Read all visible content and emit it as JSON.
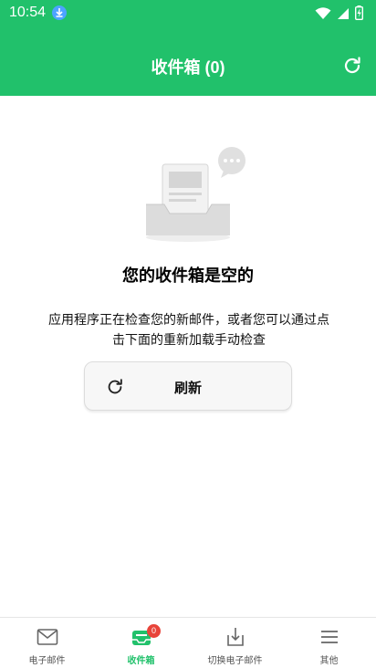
{
  "status_bar": {
    "time": "10:54",
    "icons": [
      "download-icon",
      "wifi-icon",
      "cell-signal-icon",
      "battery-icon"
    ]
  },
  "app_bar": {
    "title": "收件箱 (0)",
    "refresh_icon": "refresh-icon",
    "background": "#21c16b"
  },
  "empty_state": {
    "title": "您的收件箱是空的",
    "description": "应用程序正在检查您的新邮件，或者您可以通过点击下面的重新加载手动检查",
    "refresh_button_label": "刷新"
  },
  "bottom_nav": {
    "items": [
      {
        "label": "电子邮件",
        "icon": "mail-icon",
        "active": false
      },
      {
        "label": "收件箱",
        "icon": "inbox-icon",
        "active": true,
        "badge": "0"
      },
      {
        "label": "切换电子邮件",
        "icon": "switch-mail-icon",
        "active": false
      },
      {
        "label": "其他",
        "icon": "menu-icon",
        "active": false
      }
    ],
    "accent_color": "#21c16b",
    "badge_color": "#e8443a"
  }
}
